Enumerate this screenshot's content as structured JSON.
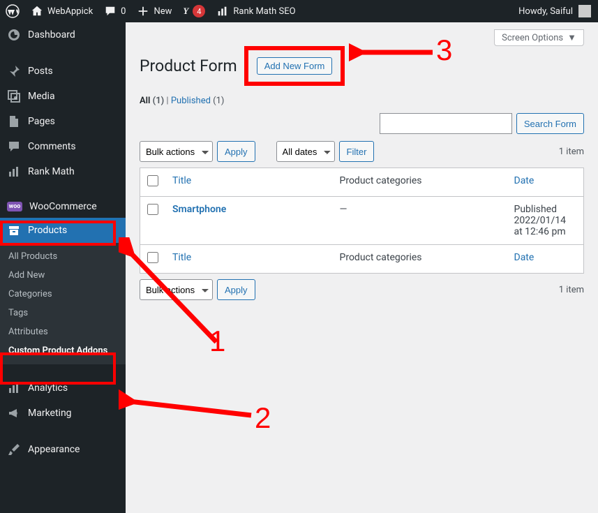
{
  "adminBar": {
    "siteName": "WebAppick",
    "commentsCount": "0",
    "newLabel": "New",
    "yoastBadge": "4",
    "rankMathLabel": "Rank Math SEO",
    "greeting": "Howdy, Saiful"
  },
  "sidebar": {
    "items": [
      {
        "label": "Dashboard",
        "icon": "dashboard"
      },
      {
        "label": "Posts",
        "icon": "pin"
      },
      {
        "label": "Media",
        "icon": "media"
      },
      {
        "label": "Pages",
        "icon": "page"
      },
      {
        "label": "Comments",
        "icon": "comment"
      },
      {
        "label": "Rank Math",
        "icon": "chart"
      },
      {
        "label": "WooCommerce",
        "icon": "woo"
      },
      {
        "label": "Products",
        "icon": "archive",
        "current": true
      },
      {
        "label": "Analytics",
        "icon": "analytics"
      },
      {
        "label": "Marketing",
        "icon": "megaphone"
      },
      {
        "label": "Appearance",
        "icon": "brush"
      }
    ],
    "submenu": [
      {
        "label": "All Products"
      },
      {
        "label": "Add New"
      },
      {
        "label": "Categories"
      },
      {
        "label": "Tags"
      },
      {
        "label": "Attributes"
      },
      {
        "label": "Custom Product Addons",
        "current": true
      }
    ]
  },
  "page": {
    "screenOptions": "Screen Options",
    "title": "Product Form",
    "addNew": "Add New Form",
    "filters": {
      "allLabel": "All",
      "allCount": "(1)",
      "publishedLabel": "Published",
      "publishedCount": "(1)"
    },
    "searchBtn": "Search Form",
    "bulkActions": "Bulk actions",
    "apply": "Apply",
    "allDates": "All dates",
    "filter": "Filter",
    "itemCount": "1 item",
    "columns": {
      "title": "Title",
      "categories": "Product categories",
      "date": "Date"
    },
    "rows": [
      {
        "title": "Smartphone",
        "categories": "—",
        "dateLabel": "Published",
        "dateValue": "2022/01/14 at 12:46 pm"
      }
    ]
  },
  "annotations": {
    "n1": "1",
    "n2": "2",
    "n3": "3"
  }
}
